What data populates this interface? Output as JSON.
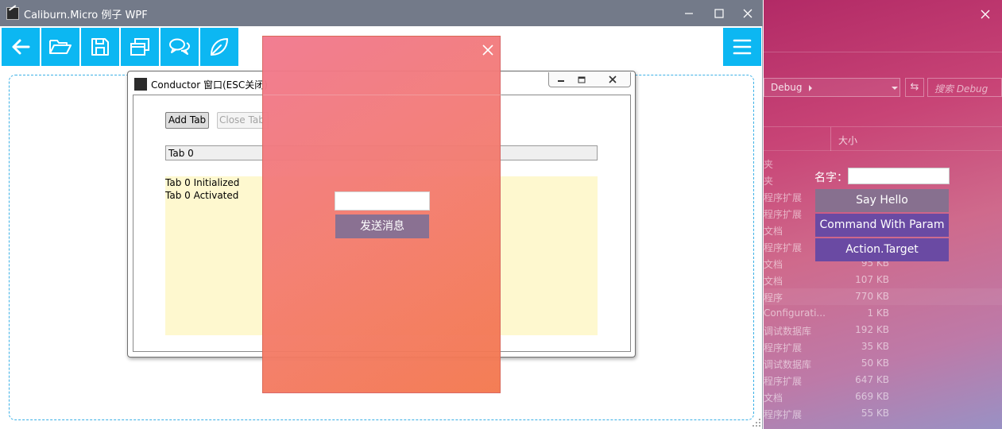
{
  "main_window": {
    "title": "Caliburn.Micro 例子 WPF",
    "toolbar_icons": [
      "back-arrow-icon",
      "open-folder-icon",
      "save-icon",
      "windows-icon",
      "chat-icon",
      "leaf-icon"
    ],
    "menu_icon": "hamburger-menu-icon"
  },
  "conductor": {
    "title": "Conductor 窗口(ESC关闭)",
    "add_tab_label": "Add Tab",
    "close_tab_label": "Close Tab",
    "active_tab": "Tab 0",
    "log": [
      "Tab 0 Initialized",
      "Tab 0 Activated"
    ]
  },
  "dialog": {
    "input_value": "",
    "send_label": "发送消息"
  },
  "right_window": {
    "breadcrumb": "Debug",
    "search_placeholder": "搜索 Debug",
    "size_header": "大小",
    "files": [
      {
        "type": "夹",
        "size": ""
      },
      {
        "type": "夹",
        "size": ""
      },
      {
        "type": "程序扩展",
        "size": ""
      },
      {
        "type": "程序扩展",
        "size": ""
      },
      {
        "type": "文档",
        "size": ""
      },
      {
        "type": "程序扩展",
        "size": ""
      },
      {
        "type": "文档",
        "size": "95 KB"
      },
      {
        "type": "文档",
        "size": "107 KB"
      },
      {
        "type": "程序",
        "size": "770 KB"
      },
      {
        "type": "Configurati...",
        "size": "1 KB"
      },
      {
        "type": "调试数据库",
        "size": "192 KB"
      },
      {
        "type": "程序扩展",
        "size": "35 KB"
      },
      {
        "type": "调试数据库",
        "size": "50 KB"
      },
      {
        "type": "程序扩展",
        "size": "647 KB"
      },
      {
        "type": "文档",
        "size": "669 KB"
      },
      {
        "type": "程序扩展",
        "size": "55 KB"
      }
    ],
    "name_label": "名字：",
    "name_value": "",
    "say_hello_label": "Say Hello",
    "command_param_label": "Command With Param",
    "action_target_label": "Action.Target"
  },
  "colors": {
    "toolbar_accent": "#0cb7f2",
    "titlebar": "#737a89",
    "dialog_button": "#8a7192",
    "action_buttons": "#6a4aa3",
    "log_background": "#fef8cf"
  }
}
